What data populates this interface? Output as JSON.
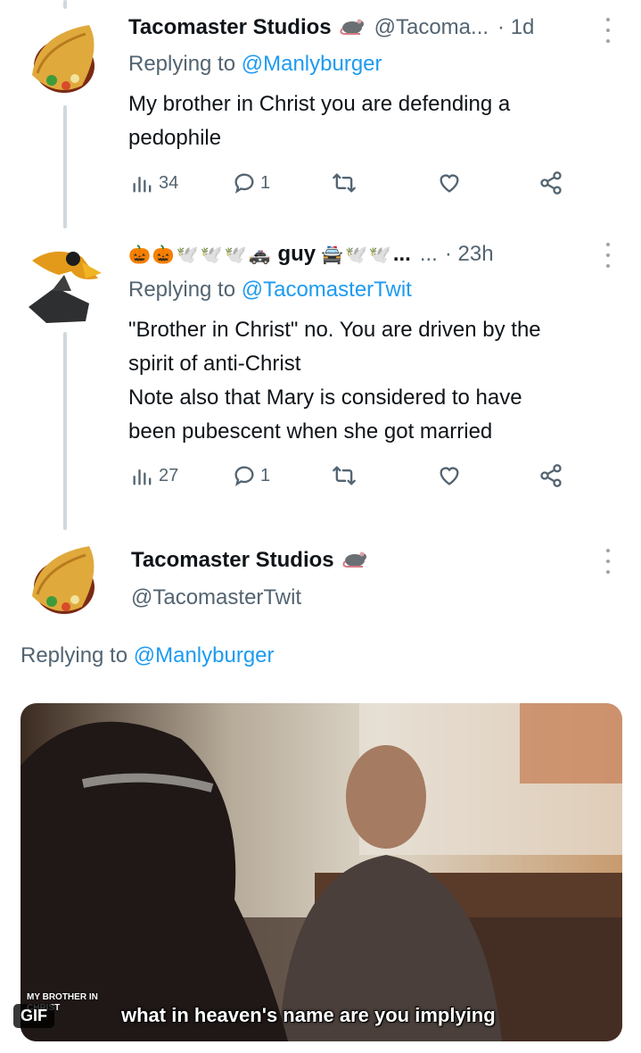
{
  "tweets": [
    {
      "name": "Tacomaster Studios",
      "badge_icon": "rat-icon",
      "handle": "@Tacoma...",
      "time": "· 1d",
      "replying_prefix": "Replying to ",
      "replying_to": "@Manlyburger",
      "text_lines": [
        "My brother in Christ you are defending a",
        "pedophile"
      ],
      "views": "34",
      "replies": "1"
    },
    {
      "name_emojis": [
        "🎃",
        "🎃",
        "🕊️",
        "🕊️",
        "🕊️",
        "🚓"
      ],
      "name": "guy",
      "name_emojis_after": [
        "🚔",
        "🕊️",
        "🕊️"
      ],
      "name_ellipsis": "...",
      "handle": "...",
      "time": "· 23h",
      "replying_prefix": "Replying to ",
      "replying_to": "@TacomasterTwit",
      "text_lines": [
        "\"Brother in Christ\" no. You are driven by the",
        "spirit of anti-Christ",
        "Note also that Mary is considered to have",
        "been pubescent when she got married"
      ],
      "views": "27",
      "replies": "1"
    }
  ],
  "main_tweet": {
    "name": "Tacomaster Studios",
    "badge_icon": "rat-icon",
    "handle": "@TacomasterTwit",
    "replying_prefix": "Replying to ",
    "replying_to": "@Manlyburger",
    "gif_badge": "GIF",
    "gif_caption": "what in heaven's name are you implying",
    "gif_small_caption": "MY BROTHER IN CHRIST"
  }
}
